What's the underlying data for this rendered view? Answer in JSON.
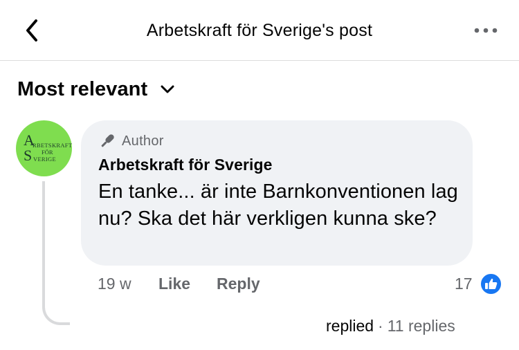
{
  "header": {
    "title": "Arbetskraft för Sverige's post",
    "back_icon": "chevron-left-icon",
    "more_icon": "more-horizontal-icon"
  },
  "sort": {
    "label": "Most relevant",
    "icon": "chevron-down-icon"
  },
  "comment": {
    "avatar": {
      "line_a": "A",
      "line_1": "RBETSKRAFT",
      "line_2": "FÖR",
      "line_s": "S",
      "line_3": "VERIGE",
      "color": "#7fdd4f"
    },
    "author_badge": "Author",
    "author_icon": "microphone-icon",
    "author_name": "Arbetskraft för Sverige",
    "text": "En tanke... är inte Barnkonventionen lag nu? Ska det här verkligen kunna ske?",
    "time": "19 w",
    "like_label": "Like",
    "reply_label": "Reply",
    "reaction_count": "17",
    "reaction_icon": "like-reaction-icon",
    "reaction_color": "#1877f2"
  },
  "replies": {
    "label": "replied",
    "separator": "·",
    "count": "11 replies"
  }
}
